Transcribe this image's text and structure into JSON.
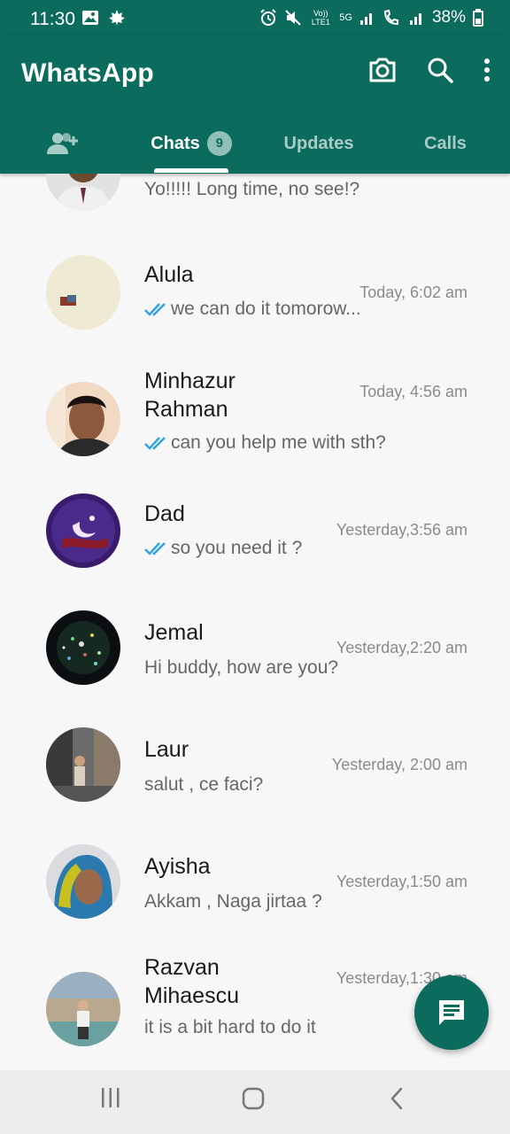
{
  "status_bar": {
    "time": "11:30",
    "network": "5G",
    "volte": "Vo)) LTE1",
    "battery": "38%",
    "icons": [
      "photo-icon",
      "maple-leaf-icon",
      "alarm-icon",
      "mute-icon",
      "signal-icon",
      "wifi-call-icon",
      "battery-icon"
    ]
  },
  "app_bar": {
    "title": "WhatsApp",
    "icons": [
      "camera-icon",
      "search-icon",
      "more-vert-icon"
    ]
  },
  "tabs": [
    {
      "label": "",
      "icon": "add-community-icon"
    },
    {
      "label": "Chats",
      "badge": "9",
      "active": true
    },
    {
      "label": "Updates"
    },
    {
      "label": "Calls"
    }
  ],
  "chats": [
    {
      "name": "",
      "preview": "Yo!!!!! Long time, no see!?",
      "time": "",
      "ticks": false
    },
    {
      "name": "Alula",
      "preview": "we can do it tomorow...",
      "time": "Today, 6:02 am",
      "ticks": true
    },
    {
      "name": "Minhazur Rahman",
      "preview": "can you help me with sth?",
      "time": "Today, 4:56 am",
      "ticks": true
    },
    {
      "name": "Dad",
      "preview": "so you need it ?",
      "time": "Yesterday,3:56 am",
      "ticks": true
    },
    {
      "name": "Jemal",
      "preview": "Hi buddy, how are you?",
      "time": "Yesterday,2:20 am",
      "ticks": false
    },
    {
      "name": "Laur",
      "preview": "salut , ce faci?",
      "time": "Yesterday, 2:00 am",
      "ticks": false
    },
    {
      "name": "Ayisha",
      "preview": "Akkam , Naga jirtaa ?",
      "time": "Yesterday,1:50 am",
      "ticks": false
    },
    {
      "name": "Razvan Mihaescu",
      "preview": "it is a bit hard to do it",
      "time": "Yesterday,1:30 am",
      "ticks": false
    }
  ],
  "fab": {
    "icon": "new-chat-icon"
  },
  "nav_bar": {
    "icons": [
      "recents-icon",
      "home-icon",
      "back-icon"
    ]
  },
  "colors": {
    "primary": "#0b6b5d",
    "tick_blue": "#34a3e0",
    "background": "#f7f7f7"
  }
}
